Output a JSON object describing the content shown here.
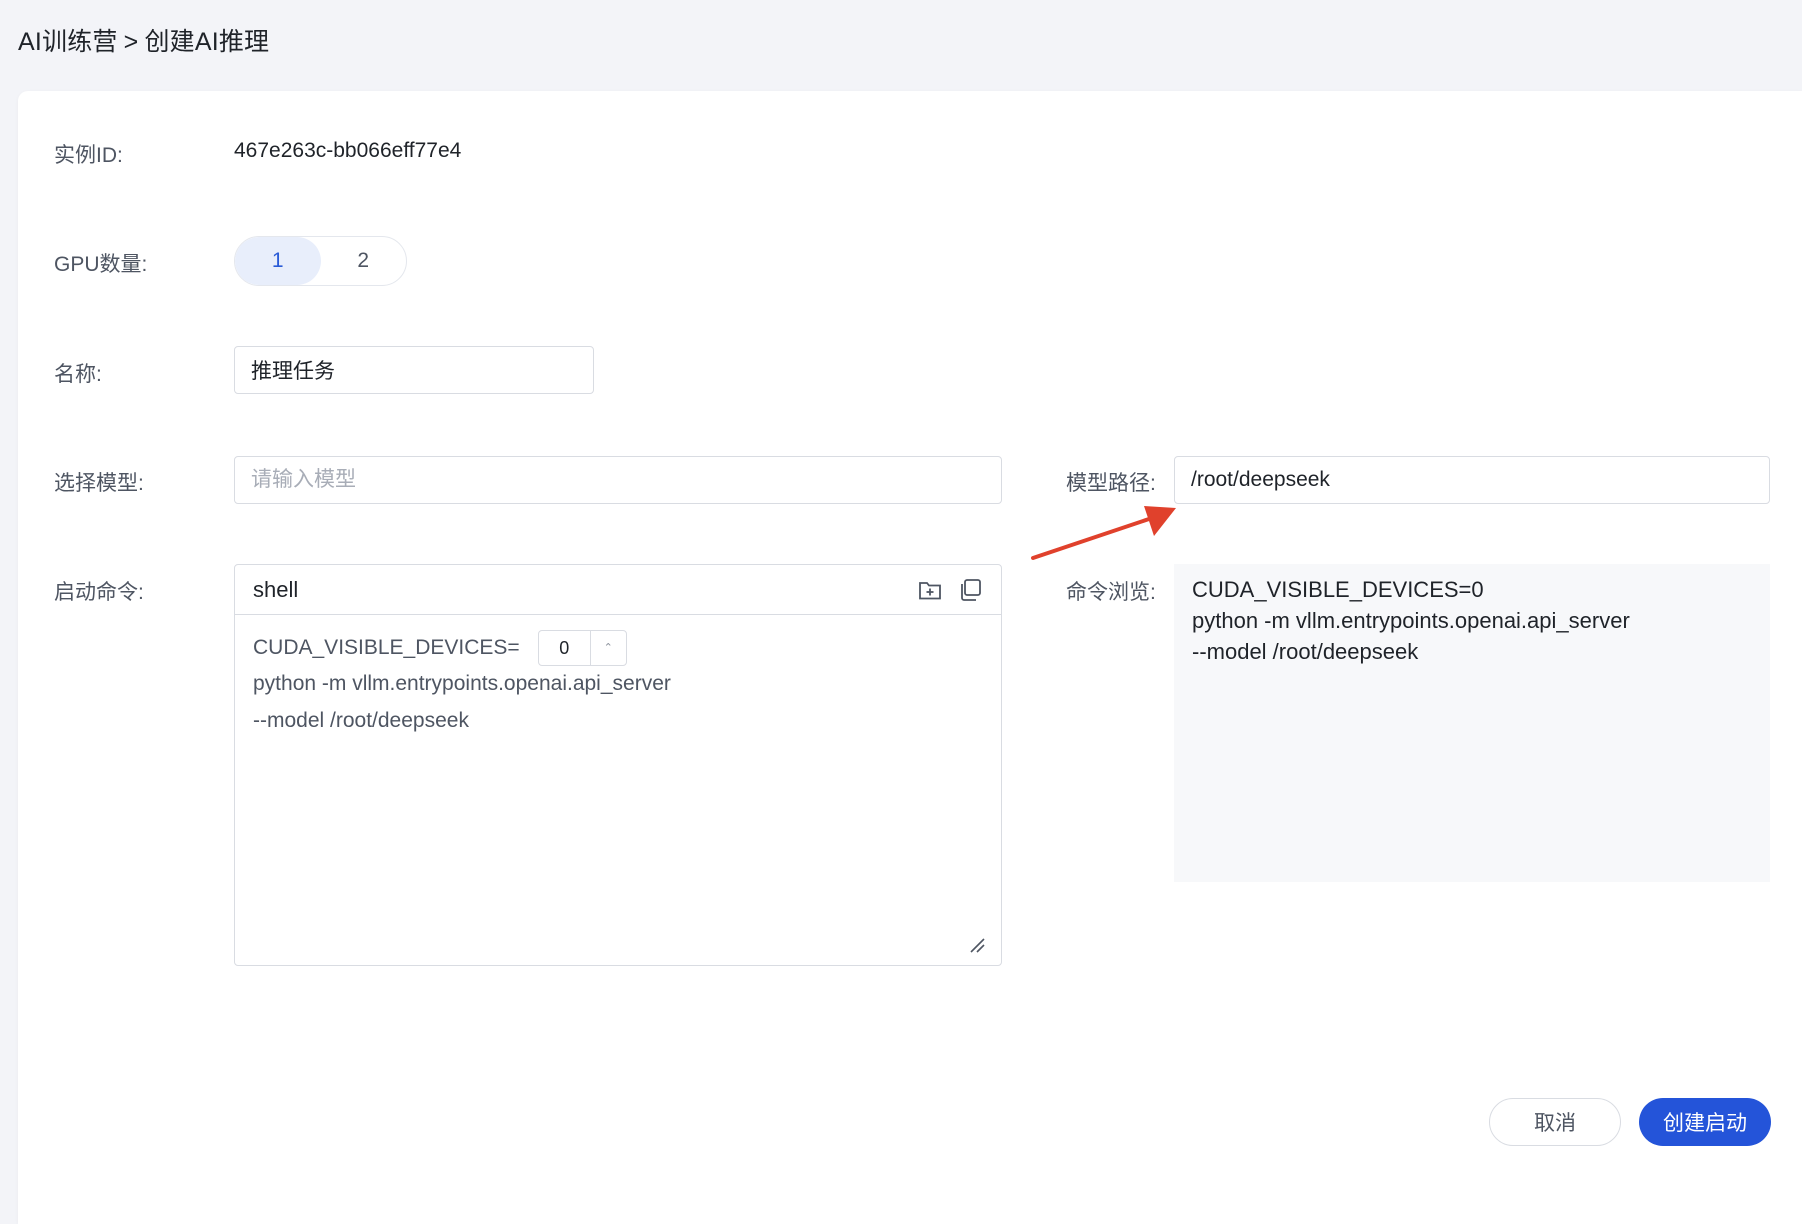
{
  "breadcrumb": {
    "parent": "AI训练营",
    "separator": ">",
    "current": "创建AI推理"
  },
  "form": {
    "instance_id": {
      "label": "实例ID:",
      "value": "467e263c-bb066eff77e4"
    },
    "gpu_count": {
      "label": "GPU数量:",
      "options": [
        "1",
        "2"
      ],
      "selected": "1"
    },
    "name": {
      "label": "名称:",
      "value": "推理任务"
    },
    "model": {
      "label": "选择模型:",
      "placeholder": "请输入模型",
      "value": ""
    },
    "model_path": {
      "label": "模型路径:",
      "value": "/root/deepseek"
    },
    "start_command": {
      "label": "启动命令:",
      "language": "shell",
      "env_prefix": "CUDA_VISIBLE_DEVICES=",
      "device_value": "0",
      "line2": "python -m vllm.entrypoints.openai.api_server",
      "line3": "--model /root/deepseek"
    },
    "command_preview": {
      "label": "命令浏览:",
      "lines": [
        "CUDA_VISIBLE_DEVICES=0",
        "python -m vllm.entrypoints.openai.api_server",
        "--model /root/deepseek"
      ]
    }
  },
  "actions": {
    "cancel_label": "取消",
    "submit_label": "创建启动"
  },
  "icons": {
    "add_folder": "folder-plus-icon",
    "copy": "copy-icon",
    "resize": "resize-handle-icon",
    "annotation_arrow": "red-arrow-annotation"
  },
  "colors": {
    "primary": "#2454d9",
    "segment_active_bg": "#e8eefb",
    "annotation": "#e0412c"
  }
}
